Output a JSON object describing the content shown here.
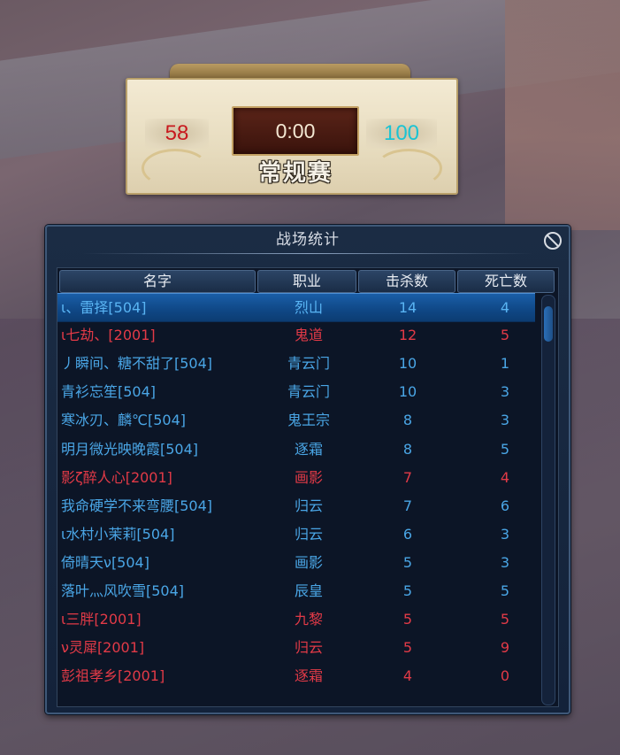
{
  "scoreboard": {
    "left_score": "58",
    "timer": "0:00",
    "right_score": "100",
    "mode": "常规赛"
  },
  "stats": {
    "title": "战场统计",
    "columns": [
      "名字",
      "职业",
      "击杀数",
      "死亡数"
    ],
    "rows": [
      {
        "name": "ι、雷择[504]",
        "class": "烈山",
        "kills": "14",
        "deaths": "4",
        "team": "blue",
        "selected": true
      },
      {
        "name": "ι七劫、[2001]",
        "class": "鬼道",
        "kills": "12",
        "deaths": "5",
        "team": "red"
      },
      {
        "name": "丿瞬间、糖不甜了[504]",
        "class": "青云门",
        "kills": "10",
        "deaths": "1",
        "team": "blue"
      },
      {
        "name": "青衫忘笙[504]",
        "class": "青云门",
        "kills": "10",
        "deaths": "3",
        "team": "blue"
      },
      {
        "name": "寒冰刃、麟℃[504]",
        "class": "鬼王宗",
        "kills": "8",
        "deaths": "3",
        "team": "blue"
      },
      {
        "name": "明月微光映晚霞[504]",
        "class": "逐霜",
        "kills": "8",
        "deaths": "5",
        "team": "blue"
      },
      {
        "name": "影ζ醉人心[2001]",
        "class": "画影",
        "kills": "7",
        "deaths": "4",
        "team": "red"
      },
      {
        "name": "我命硬学不来弯腰[504]",
        "class": "归云",
        "kills": "7",
        "deaths": "6",
        "team": "blue"
      },
      {
        "name": "ι水村小茉莉[504]",
        "class": "归云",
        "kills": "6",
        "deaths": "3",
        "team": "blue"
      },
      {
        "name": "倚晴天ν[504]",
        "class": "画影",
        "kills": "5",
        "deaths": "3",
        "team": "blue"
      },
      {
        "name": "落叶灬风吹雪[504]",
        "class": "辰皇",
        "kills": "5",
        "deaths": "5",
        "team": "blue"
      },
      {
        "name": "ι三胖[2001]",
        "class": "九黎",
        "kills": "5",
        "deaths": "5",
        "team": "red"
      },
      {
        "name": "ν灵犀[2001]",
        "class": "归云",
        "kills": "5",
        "deaths": "9",
        "team": "red"
      },
      {
        "name": "彭祖孝乡[2001]",
        "class": "逐霜",
        "kills": "4",
        "deaths": "0",
        "team": "red"
      }
    ]
  },
  "colors": {
    "team_blue": "#4aa6e6",
    "team_red": "#e23a47"
  },
  "icons": {
    "close": "close-icon"
  }
}
